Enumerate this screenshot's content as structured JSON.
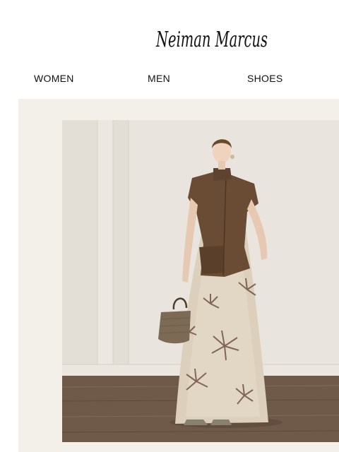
{
  "brand": {
    "name": "Neiman Marcus"
  },
  "nav": {
    "items": [
      {
        "label": "WOMEN"
      },
      {
        "label": "MEN"
      },
      {
        "label": "SHOES"
      }
    ]
  },
  "hero": {
    "image_description_icon": "model-photo",
    "colors": {
      "background": "#f3f0e9",
      "wall": "#e8e4dc",
      "floor": "#6e5848",
      "vest": "#6a4c34"
    }
  }
}
